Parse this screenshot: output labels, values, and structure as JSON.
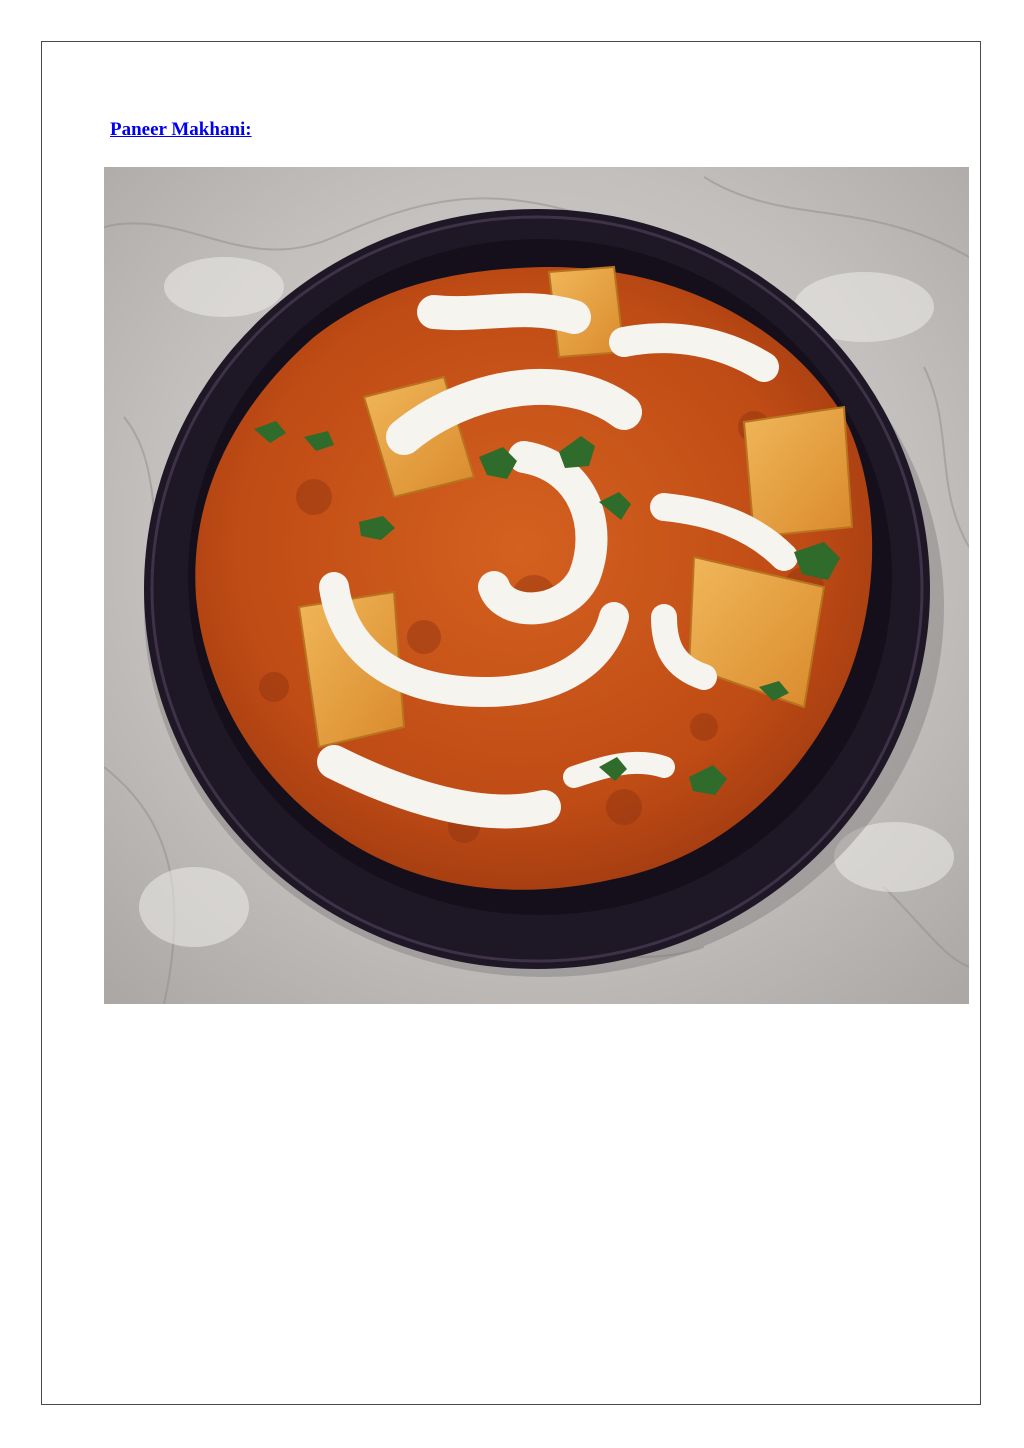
{
  "heading": {
    "text": "Paneer Makhani:",
    "color": "#0000ee"
  },
  "photo": {
    "subject": "paneer-makhani-bowl",
    "palette": {
      "marble": "#c9c6c4",
      "bowl": "#1e1826",
      "gravy": "#c6511a",
      "cream": "#f6f4ef",
      "paneer": "#e8a64a",
      "cilantro": "#2f6b2a"
    }
  }
}
